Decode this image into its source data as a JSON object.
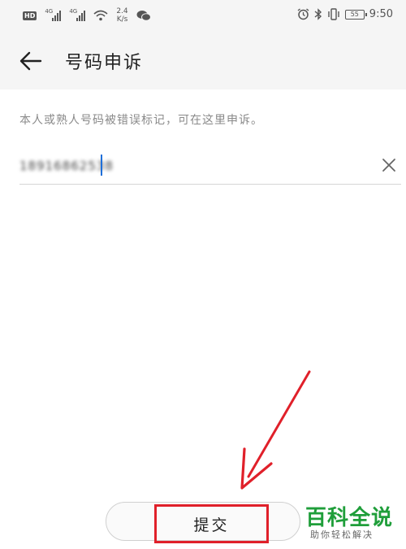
{
  "status_bar": {
    "hd": "HD",
    "net1": "4G",
    "net2": "4G",
    "speed_top": "2.4",
    "speed_bottom": "K/s",
    "battery": "55",
    "time": "9:50"
  },
  "header": {
    "title": "号码申诉"
  },
  "form": {
    "hint": "本人或熟人号码被错误标记，可在这里申诉。",
    "number_value": "18916862538"
  },
  "actions": {
    "submit_label": "提交"
  },
  "watermark": {
    "logo": "百科全说",
    "sub": "助你轻松解决"
  },
  "colors": {
    "highlight": "#e0202a",
    "caret": "#1e6fd9",
    "watermark": "#1f9e3a"
  }
}
